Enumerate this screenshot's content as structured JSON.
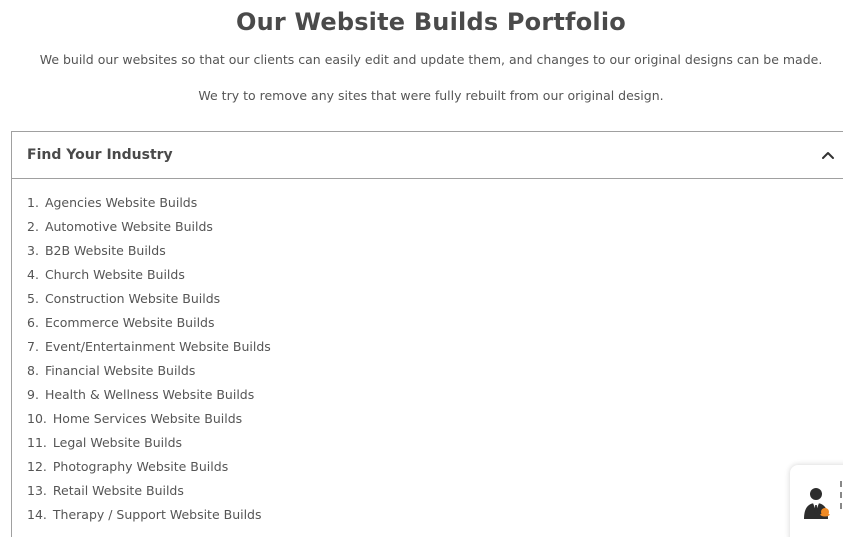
{
  "header": {
    "title": "Our Website Builds Portfolio",
    "intro_line_1": "We build our websites so that our clients can easily edit and update them, and changes to our original designs can be made.",
    "intro_line_2": "We try to remove any sites that were fully rebuilt from our original design."
  },
  "accordion": {
    "title": "Find Your Industry",
    "expanded": true,
    "toggle_icon": "chevron-up-icon",
    "items": [
      {
        "num": "1.",
        "label": "Agencies Website Builds"
      },
      {
        "num": "2.",
        "label": "Automotive Website Builds"
      },
      {
        "num": "3.",
        "label": "B2B Website Builds"
      },
      {
        "num": "4.",
        "label": "Church Website Builds"
      },
      {
        "num": "5.",
        "label": "Construction Website Builds"
      },
      {
        "num": "6.",
        "label": "Ecommerce Website Builds"
      },
      {
        "num": "7.",
        "label": "Event/Entertainment Website Builds"
      },
      {
        "num": "8.",
        "label": "Financial Website Builds"
      },
      {
        "num": "9.",
        "label": "Health & Wellness Website Builds"
      },
      {
        "num": "10.",
        "label": "Home Services Website Builds"
      },
      {
        "num": "11.",
        "label": "Legal Website Builds"
      },
      {
        "num": "12.",
        "label": "Photography Website Builds"
      },
      {
        "num": "13.",
        "label": "Retail Website Builds"
      },
      {
        "num": "14.",
        "label": "Therapy / Support Website Builds"
      }
    ]
  },
  "chat_widget": {
    "icon": "support-agent-icon",
    "accent_color": "#f08a24"
  },
  "colors": {
    "heading": "#4a4a4a",
    "text": "#555555",
    "border": "#a0a0a0",
    "background": "#ffffff"
  }
}
